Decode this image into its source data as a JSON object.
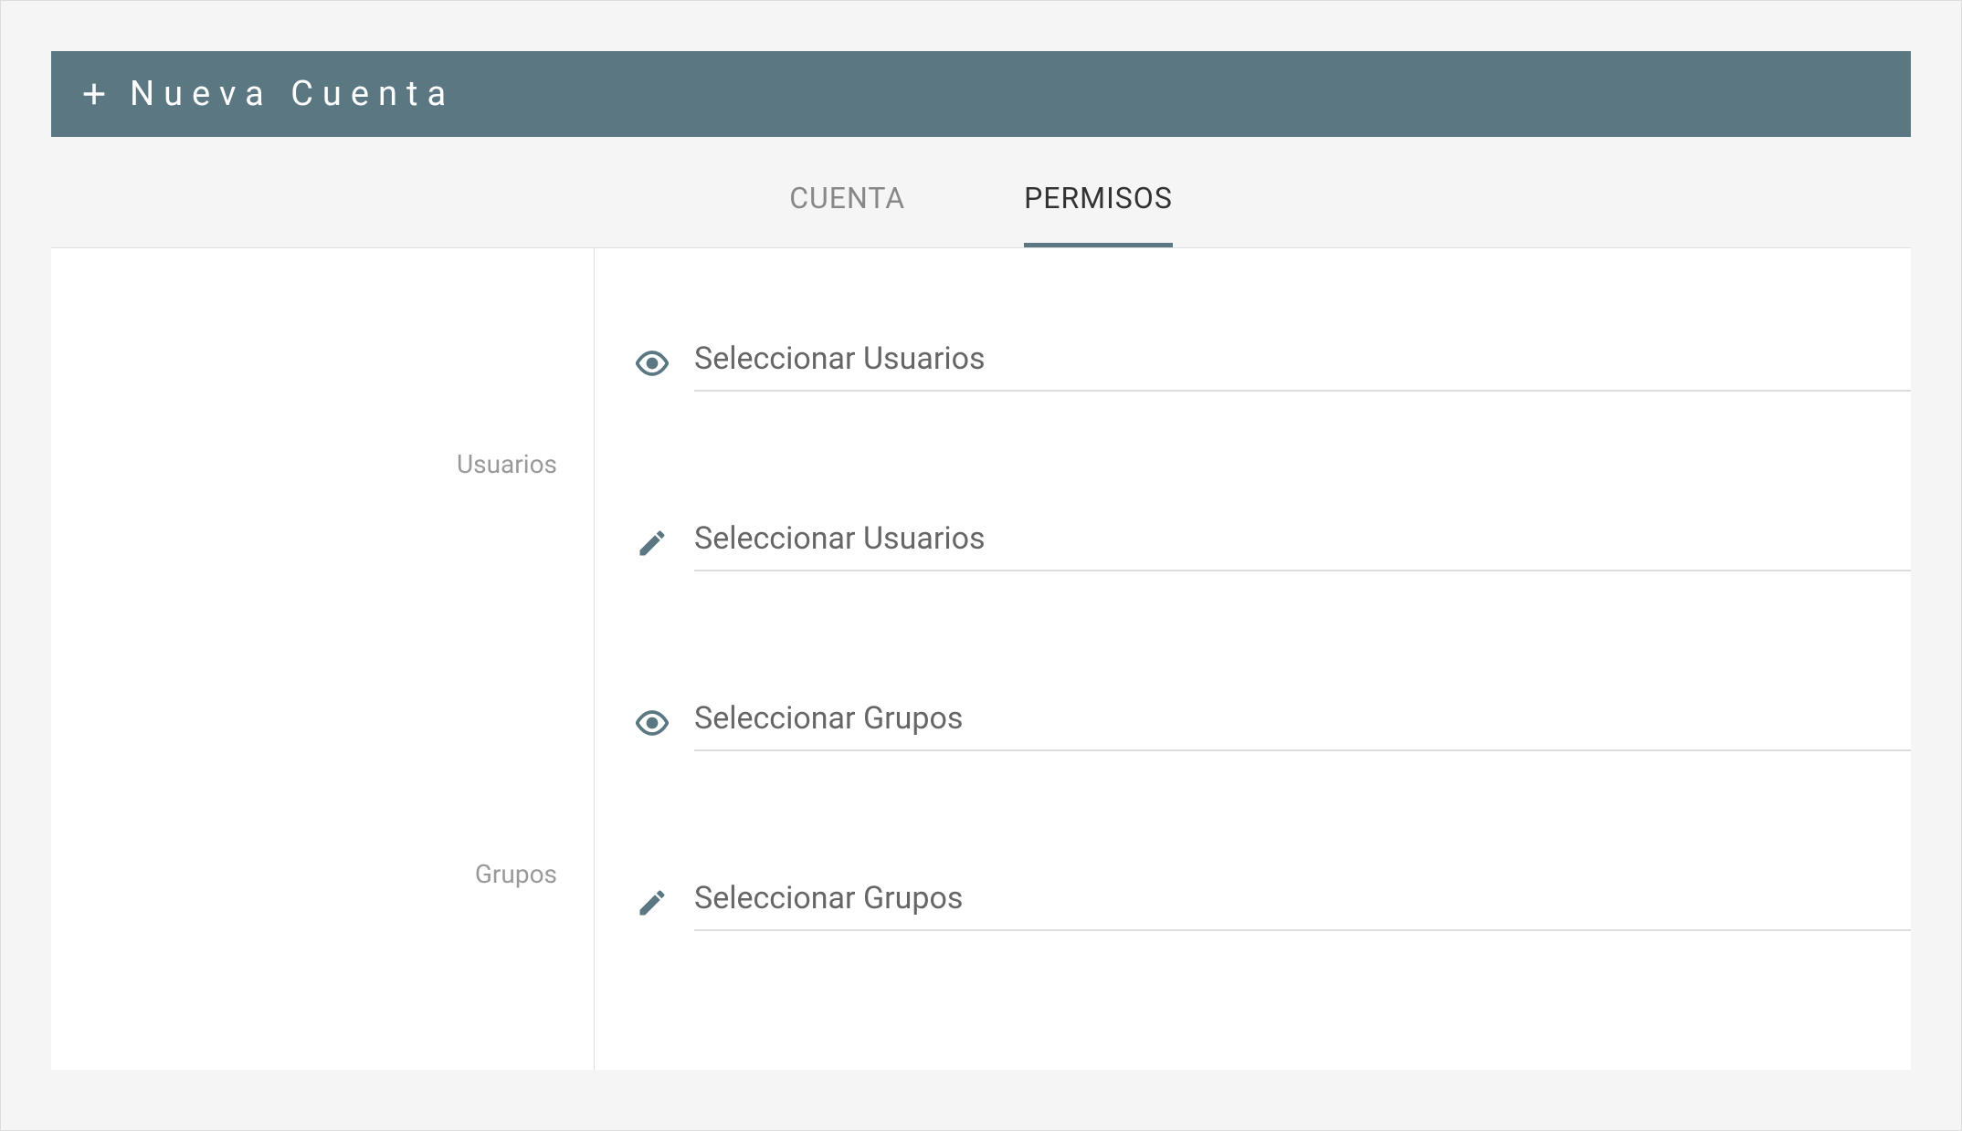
{
  "header": {
    "title": "Nueva Cuenta"
  },
  "tabs": [
    {
      "label": "CUENTA",
      "active": false
    },
    {
      "label": "PERMISOS",
      "active": true
    }
  ],
  "sidebar": {
    "users_label": "Usuarios",
    "groups_label": "Grupos"
  },
  "fields": {
    "users_view_placeholder": "Seleccionar Usuarios",
    "users_edit_placeholder": "Seleccionar Usuarios",
    "groups_view_placeholder": "Seleccionar Grupos",
    "groups_edit_placeholder": "Seleccionar Grupos"
  }
}
